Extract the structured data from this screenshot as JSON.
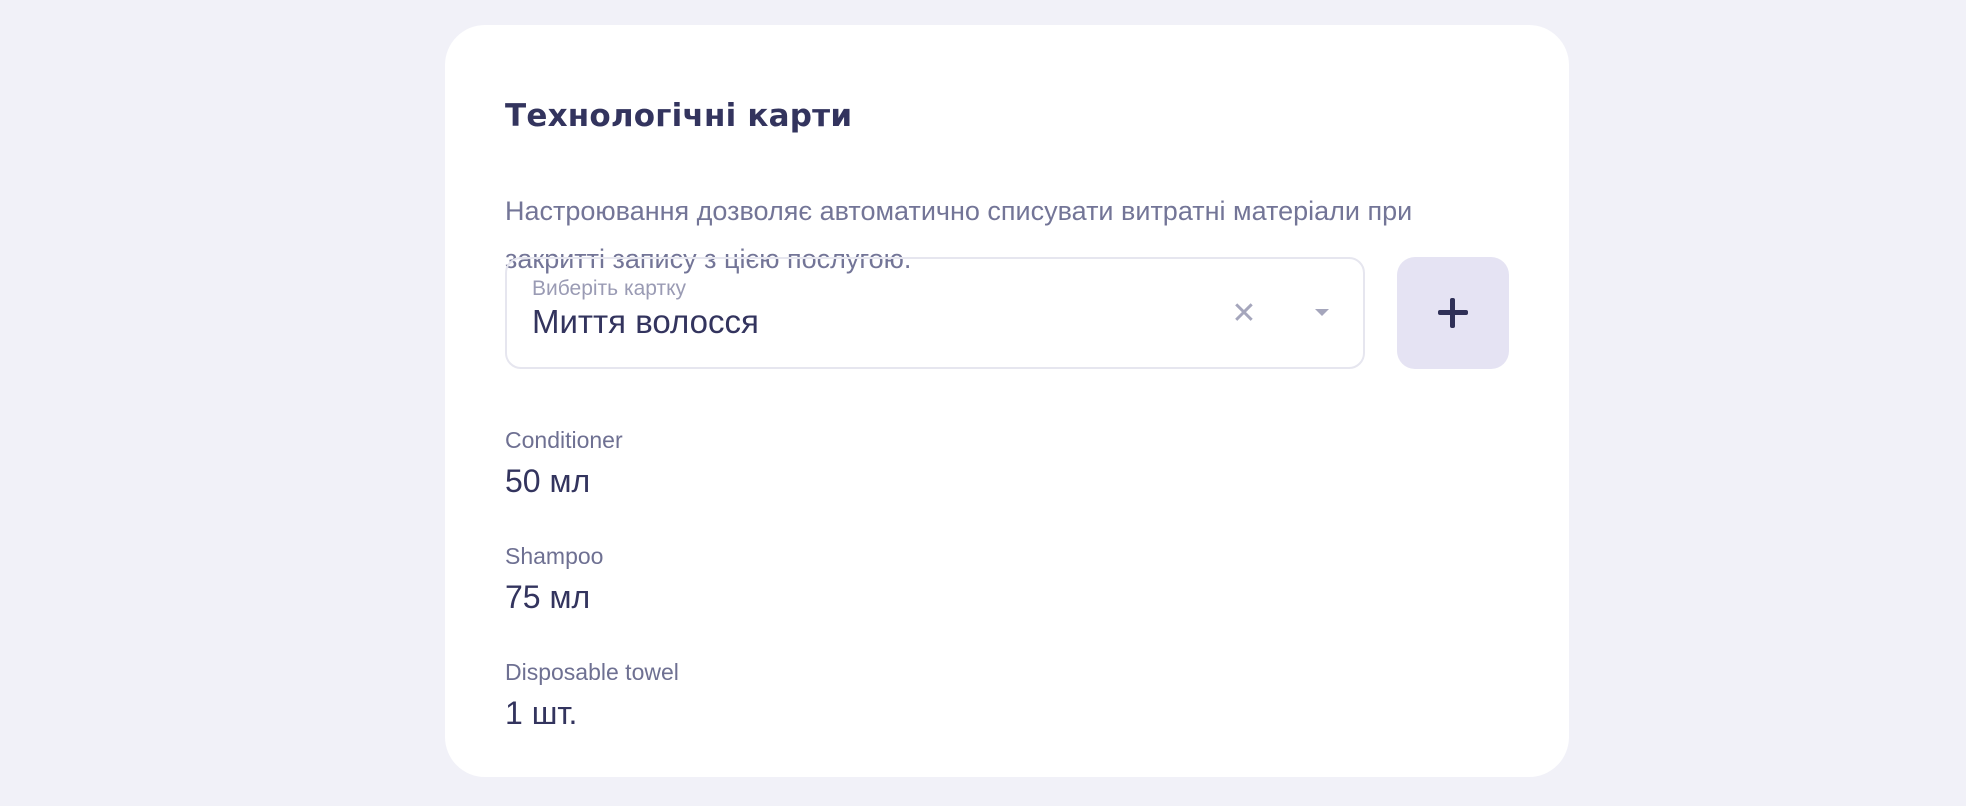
{
  "card": {
    "title": "Технологічні карти",
    "description": "Настроювання дозволяє автоматично списувати витратні матеріали при закритті запису з цією послугою."
  },
  "select": {
    "label": "Виберіть картку",
    "value": "Миття волосся",
    "clear_glyph": "✕",
    "clear_icon": "close-icon",
    "arrow_icon": "chevron-down-icon"
  },
  "add_button": {
    "icon": "plus-icon"
  },
  "materials": [
    {
      "name": "Conditioner",
      "amount": "50 мл"
    },
    {
      "name": "Shampoo",
      "amount": "75 мл"
    },
    {
      "name": "Disposable towel",
      "amount": "1 шт."
    }
  ],
  "colors": {
    "page_background": "#f1f1f8",
    "card_background": "#ffffff",
    "title": "#33345e",
    "description": "#737597",
    "add_button_background": "#e5e3f3"
  }
}
